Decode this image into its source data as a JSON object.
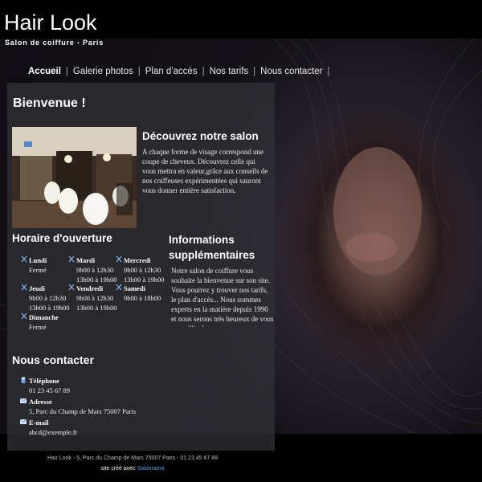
{
  "header": {
    "logo": "Hair Look",
    "tagline": "Salon de coiffure - Paris"
  },
  "nav": [
    {
      "label": "Accueil",
      "active": true
    },
    {
      "label": "Galerie photos",
      "active": false
    },
    {
      "label": "Plan d'accès",
      "active": false
    },
    {
      "label": "Nos tarifs",
      "active": false
    },
    {
      "label": "Nous contacter",
      "active": false
    }
  ],
  "welcome": {
    "title": "Bienvenue !"
  },
  "discover": {
    "title": "Découvrez notre salon",
    "text": "A chaque forme de visage correspond une coupe de cheveux. Découvrez celle qui vous mettra en valeur,grâce aux conseils de nos coiffeuses expérimentées qui sauront vous donner entière satisfaction."
  },
  "hours": {
    "title": "Horaire d'ouverture",
    "days": [
      {
        "day": "Lundi",
        "lines": [
          "Fermé"
        ]
      },
      {
        "day": "Mardi",
        "lines": [
          "9h00 à 12h30",
          "13h00 à 19h00"
        ]
      },
      {
        "day": "Mercredi",
        "lines": [
          "9h00 à 12h30",
          "13h00 à 19h00"
        ]
      },
      {
        "day": "Jeudi",
        "lines": [
          "9h00 à 12h30",
          "13h00 à 19h00"
        ]
      },
      {
        "day": "Vendredi",
        "lines": [
          "9h00 à 12h30",
          "13h00 à 19h00"
        ]
      },
      {
        "day": "Samedi",
        "lines": [
          "9h00 à 18h00"
        ]
      },
      {
        "day": "Dimanche",
        "lines": [
          "Fermé"
        ]
      }
    ]
  },
  "info": {
    "title": "Informations supplémentaires",
    "text": "Notre salon de coiffure vous souhaite la bienvenue sur son site. Vous pourrez y trouver nos tarifs, le plan d'accès... Nous sommes experts en la matière depuis 1990 et nous serons très heureux de vous accueillir dans"
  },
  "contact": {
    "title": "Nous contacter",
    "items": [
      {
        "label": "Téléphone",
        "value": "01 23 45 67 89",
        "icon": "phone-icon"
      },
      {
        "label": "Adresse",
        "value": "5, Parc du Champ de Mars 75007 Paris",
        "icon": "envelope-icon"
      },
      {
        "label": "E-mail",
        "value": "abcd@exemple.fr",
        "icon": "mail-icon"
      }
    ]
  },
  "footer": {
    "line": "Hair Look - 5, Parc du Champ de Mars 75007 Paris - 01 23 45 67 89",
    "credit_prefix": "site créé avec ",
    "credit_brand": "Salonrama"
  },
  "colors": {
    "panel": "#303034",
    "link_blue": "#5aa0e6",
    "icon_blue": "#6f9fd8"
  }
}
